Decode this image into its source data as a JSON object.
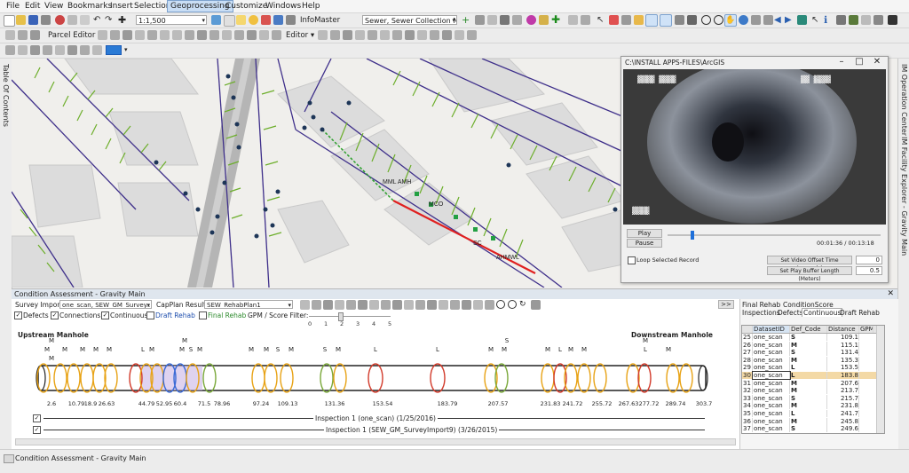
{
  "menubar": {
    "items": [
      "File",
      "Edit",
      "View",
      "Bookmarks",
      "Insert",
      "Selection",
      "Geoprocessing",
      "Customize",
      "Windows",
      "Help"
    ],
    "active": "Geoprocessing"
  },
  "toolbar1": {
    "scale": "1:1,500",
    "infomaster_label": "InfoMaster",
    "layer_select": "Sewer, Sewer Collection Ne"
  },
  "toolbar2": {
    "parcel_editor": "Parcel Editor",
    "editor": "Editor"
  },
  "toc": {
    "label": "Table Of Contents"
  },
  "right_dock": {
    "label1": "IM Operation Center",
    "label2": "IM Facility Explorer - Gravity Main"
  },
  "map": {
    "labels": [
      "MML AMH",
      "MCO",
      "SC",
      "AHMWL"
    ]
  },
  "video": {
    "title": "C:\\INSTALL APPS-FILES\\ArcGIS",
    "play": "Play",
    "pause": "Pause",
    "time": "00:01:36 / 00:13:18",
    "loop_label": "Loop Selected Record",
    "offset_btn": "Set Video Offset Time (seconds)",
    "offset_val": "0",
    "buffer_btn": "Set Play Buffer Length (Meters)",
    "buffer_val": "0.5"
  },
  "ca": {
    "title": "Condition Assessment - Gravity Main",
    "survey_import_label": "Survey Import",
    "survey_import_value": "one_scan, SEW_GM_Survey...",
    "capplan_label": "CapPlan Result",
    "capplan_value": "SEW_RehabPlan1",
    "checks": {
      "defects": "Defects",
      "connections": "Connections",
      "continuous": "Continuous",
      "draft": "Draft Rehab",
      "final": "Final Rehab",
      "filter": "GPM / Score Filter:"
    },
    "slider_ticks": [
      "0",
      "1",
      "2",
      "3",
      "4",
      "5"
    ],
    "upstream": "Upstream Manhole",
    "downstream": "Downstream Manhole",
    "distances": [
      "2.6",
      "10.79",
      "18.9",
      "26.63",
      "44.79",
      "52.95",
      "60.4",
      "71.5",
      "78.96",
      "97.24",
      "109.13",
      "131.36",
      "153.54",
      "183.79",
      "207.57",
      "231.83",
      "241.72",
      "255.72",
      "267.63",
      "277.72",
      "289.74",
      "303.7"
    ],
    "inspection1": "Inspection 1 (one_scan) (1/25/2016)",
    "inspection2": "Inspection 1 (SEW_GM_SurveyImport9) (3/26/2015)",
    "collapse_btn": ">>",
    "right_tabs_top": [
      "Final Rehab",
      "ConditionScore"
    ],
    "right_tabs": [
      "Inspections",
      "Defects",
      "Continuous",
      "Draft Rehab"
    ],
    "grid_headers": [
      "DatasetID",
      "Def_Code",
      "Distance",
      "GPM"
    ],
    "rows": [
      {
        "n": "25",
        "id": "one_scan",
        "code": "S",
        "dist": "109.1"
      },
      {
        "n": "26",
        "id": "one_scan",
        "code": "M",
        "dist": "115.1"
      },
      {
        "n": "27",
        "id": "one_scan",
        "code": "S",
        "dist": "131.4"
      },
      {
        "n": "28",
        "id": "one_scan",
        "code": "M",
        "dist": "135.3"
      },
      {
        "n": "29",
        "id": "one_scan",
        "code": "L",
        "dist": "153.5"
      },
      {
        "n": "30",
        "id": "one_scan",
        "code": "L",
        "dist": "183.8"
      },
      {
        "n": "31",
        "id": "one_scan",
        "code": "M",
        "dist": "207.6"
      },
      {
        "n": "32",
        "id": "one_scan",
        "code": "M",
        "dist": "213.7"
      },
      {
        "n": "33",
        "id": "one_scan",
        "code": "S",
        "dist": "215.7"
      },
      {
        "n": "34",
        "id": "one_scan",
        "code": "M",
        "dist": "231.8"
      },
      {
        "n": "35",
        "id": "one_scan",
        "code": "L",
        "dist": "241.7"
      },
      {
        "n": "36",
        "id": "one_scan",
        "code": "M",
        "dist": "245.8"
      },
      {
        "n": "37",
        "id": "one_scan",
        "code": "S",
        "dist": "249.6"
      }
    ]
  },
  "statusbar": {
    "label": "Condition Assessment - Gravity Main"
  }
}
